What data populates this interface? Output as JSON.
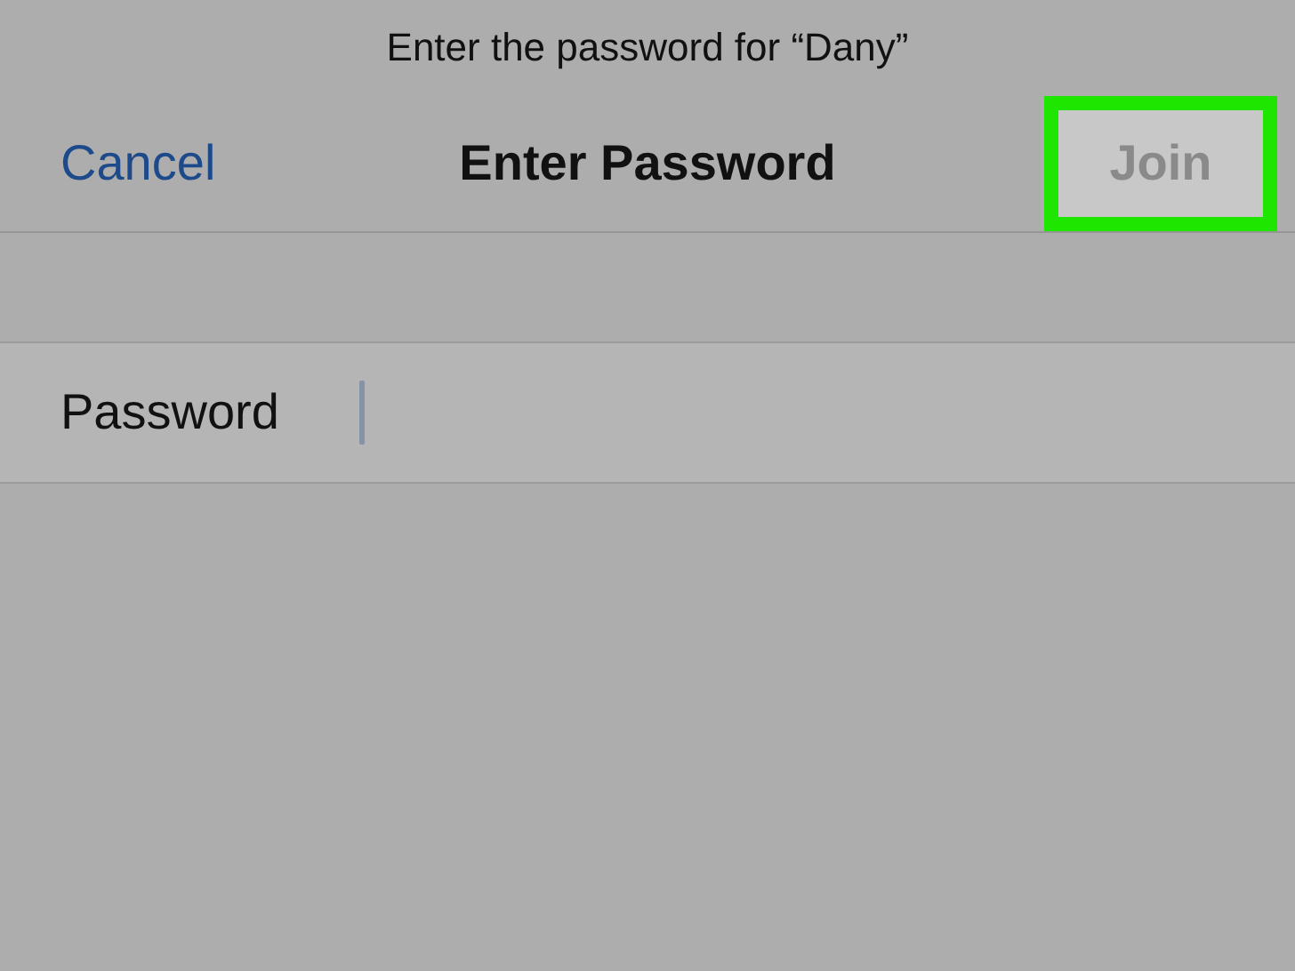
{
  "prompt": "Enter the password for “Dany”",
  "nav_bar": {
    "cancel": "Cancel",
    "title": "Enter Password",
    "join": {
      "label": "Join",
      "disabled": true,
      "highlighted": true
    }
  },
  "field": {
    "label": "Password",
    "focused": true
  }
}
